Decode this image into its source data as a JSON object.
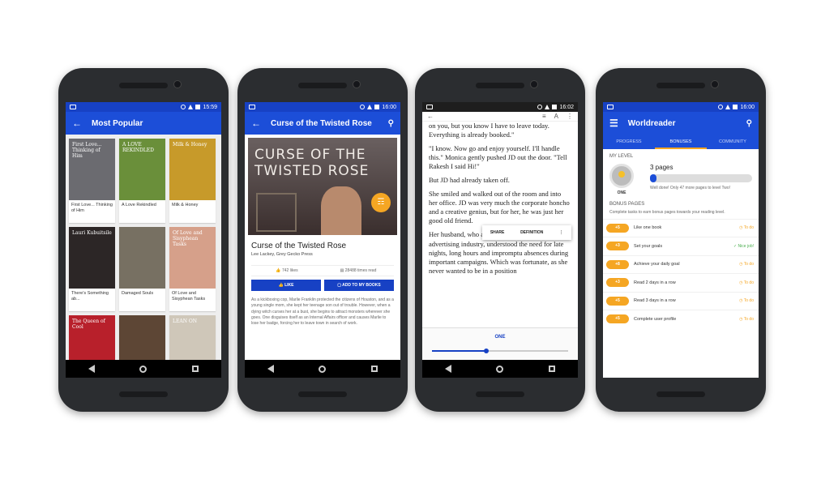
{
  "phone1": {
    "status_time": "15:59",
    "title": "Most Popular",
    "books": [
      {
        "name": "First Love... Thinking of Him",
        "cover_text": "First Love... Thinking of Him",
        "color": "#6b6b70"
      },
      {
        "name": "A Love Rekindled",
        "cover_text": "A LOVE REKINDLED",
        "color": "#6a8f3a"
      },
      {
        "name": "Milk & Honey",
        "cover_text": "Milk & Honey",
        "color": "#c79a2a"
      },
      {
        "name": "There's Something ab...",
        "cover_text": "Lauri Kubuitsile",
        "color": "#2c2626"
      },
      {
        "name": "Damaged Souls",
        "cover_text": "",
        "color": "#777062"
      },
      {
        "name": "Of Love and Sisyphean Tasks",
        "cover_text": "Of Love and Sisyphean Tasks",
        "color": "#d6a08a"
      },
      {
        "name": "",
        "cover_text": "The Queen of Cool",
        "color": "#b8202b"
      },
      {
        "name": "",
        "cover_text": "",
        "color": "#5d4635"
      },
      {
        "name": "",
        "cover_text": "LEAN ON",
        "color": "#cfc7b9"
      }
    ]
  },
  "phone2": {
    "status_time": "16:00",
    "title": "Curse of the Twisted Rose",
    "cover_title": "CURSE OF THE TWISTED ROSE",
    "book_title": "Curse of the Twisted Rose",
    "author": "Lee Lackey, Grey Gecko Press",
    "likes": "742 likes",
    "reads": "28488 times read",
    "like_label": "LIKE",
    "add_label": "ADD TO MY BOOKS",
    "description": "As a kickboxing cop, Marlie Franklin protected the citizens of Houston, and as a young single mom, she kept her teenage son out of trouble. However, when a dying witch curses her at a bust, she begins to attract monsters wherever she goes. One disguises itself as an Internal Affairs officer and causes Marlie to lose her badge, forcing her to leave town in search of work."
  },
  "phone3": {
    "status_time": "16:02",
    "p1": "on you, but you know I have to leave today. Everything is already booked.\"",
    "p2": "\"I know. Now go and enjoy yourself. I'll handle this.\" Monica gently pushed JD out the door. \"Tell Rakesh I said Hi!\"",
    "p3": "But JD had already taken off.",
    "p4": "She smiled and walked out of the room and into her office. JD was very much the corporate honcho and a creative genius, but for her, he was just her good old friend.",
    "p5_before": "Her husband, who also ",
    "p5_highlight": "happened",
    "p5_after": " to be in the advertising industry, understood the need for late nights, long hours and impromptu absences during important campaigns. Which was fortunate, as she never wanted to be in a position",
    "share_label": "SHARE",
    "definition_label": "DEFINITION",
    "chapter": "ONE",
    "progress": 0.4
  },
  "phone4": {
    "status_time": "16:00",
    "title": "Worldreader",
    "tabs": [
      "PROGRESS",
      "BONUSES",
      "COMMUNITY"
    ],
    "my_level_label": "MY LEVEL",
    "level_name": "ONE",
    "pages": "3 pages",
    "progress": 0.06,
    "level_note": "Well done! Only 47 more pages to level Two!",
    "bonus_label": "BONUS PAGES",
    "bonus_intro": "Complete tasks to earn bonus pages towards your reading level.",
    "bonuses": [
      {
        "points": "+5",
        "task": "Like one book",
        "status": "To do"
      },
      {
        "points": "+3",
        "task": "Set your goals",
        "status": "Nice job!"
      },
      {
        "points": "+8",
        "task": "Achieve your daily goal",
        "status": "To do"
      },
      {
        "points": "+3",
        "task": "Read 2 days in a row",
        "status": "To do"
      },
      {
        "points": "+5",
        "task": "Read 3 days in a row",
        "status": "To do"
      },
      {
        "points": "+5",
        "task": "Complete user profile",
        "status": "To do"
      }
    ]
  }
}
